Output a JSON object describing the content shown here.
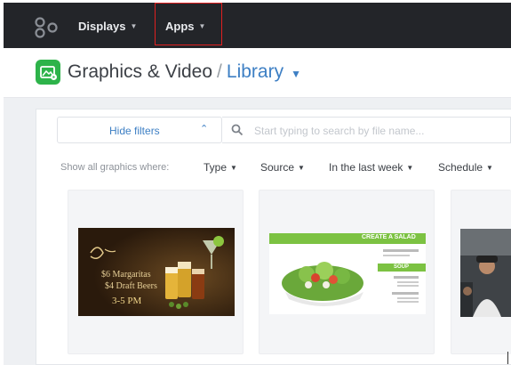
{
  "nav": {
    "items": [
      {
        "label": "Displays"
      },
      {
        "label": "Apps"
      }
    ]
  },
  "header": {
    "title": "Graphics & Video",
    "separator": "/",
    "section": "Library"
  },
  "filters": {
    "hide_label": "Hide filters",
    "search_placeholder": "Start typing to search by file name...",
    "lead_text": "Show all graphics where:",
    "dropdowns": [
      {
        "label": "Type"
      },
      {
        "label": "Source"
      },
      {
        "label": "In the last week"
      },
      {
        "label": "Schedule"
      }
    ]
  },
  "cards": [
    {
      "thumb_lines": [
        "$6 Margaritas",
        "$4 Draft Beers",
        "3-5 PM"
      ]
    },
    {
      "thumb_title": "CREATE A SALAD",
      "thumb_section": "SOUP"
    },
    {}
  ],
  "colors": {
    "nav_bg": "#232529",
    "accent": "#3d7fc4",
    "brand_green": "#2db34a",
    "highlight": "#e02020",
    "salad_green": "#7cc242"
  }
}
